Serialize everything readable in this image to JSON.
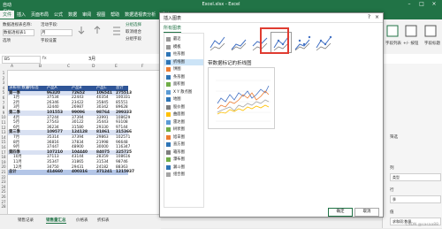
{
  "app": {
    "title": "Excel.xlsx - Excel",
    "icon_label": "自动保存"
  },
  "ribbon_tabs": [
    "文件",
    "插入",
    "页面布局",
    "公式",
    "数据",
    "审阅",
    "视图",
    "帮助",
    "数据透视表分析",
    "设计"
  ],
  "active_ribbon_tab": 0,
  "ribbon": {
    "pivot_name_label": "数据透视表名称:",
    "pivot_name_value": "数据透视表1",
    "active_field_label": "活动字段:",
    "active_field_value": "月",
    "options_label": "选项",
    "field_settings_label": "字段设置",
    "group_select_label": "分组选择",
    "ungroup_label": "取消组合",
    "group_field_label": "分组字段",
    "field_list_label": "字段列表",
    "buttons_label": "+/- 按钮",
    "field_headers_label": "字段标题"
  },
  "formula_bar": {
    "name_box": "B5",
    "fx": "fx",
    "value": "3月"
  },
  "columns": [
    "A",
    "B",
    "C",
    "D",
    "E",
    "F"
  ],
  "rows": [
    "1",
    "2",
    "3",
    "4",
    "5",
    "6",
    "7",
    "8",
    "9",
    "10",
    "11",
    "12",
    "13",
    "14",
    "15",
    "16",
    "17",
    "18",
    "19",
    "20",
    "21",
    "22",
    "23",
    "24",
    "25",
    "26",
    "27",
    "28"
  ],
  "pivot": {
    "header": [
      "求和项:数量",
      "列标签",
      "产品A",
      "产品B",
      "产品C",
      "总计"
    ],
    "rows": [
      {
        "type": "quarter",
        "label": "第一季",
        "v": [
          "96320",
          "72652",
          "106541",
          "275513"
        ]
      },
      {
        "type": "month",
        "label": "1月",
        "v": [
          "37534",
          "22443",
          "40354",
          "100331"
        ]
      },
      {
        "type": "month",
        "label": "2月",
        "v": [
          "26346",
          "23422",
          "35845",
          "85551"
        ]
      },
      {
        "type": "month",
        "label": "3月",
        "v": [
          "32440",
          "26987",
          "30342",
          "89628"
        ]
      },
      {
        "type": "quarter",
        "label": "第二季",
        "v": [
          "101553",
          "99096",
          "98764",
          "299333"
        ]
      },
      {
        "type": "month",
        "label": "4月",
        "v": [
          "37244",
          "37394",
          "33991",
          "108629"
        ]
      },
      {
        "type": "month",
        "label": "5月",
        "v": [
          "27543",
          "30122",
          "35443",
          "93108"
        ]
      },
      {
        "type": "month",
        "label": "6月",
        "v": [
          "36234",
          "31580",
          "29330",
          "97144"
        ]
      },
      {
        "type": "quarter",
        "label": "第三季",
        "v": [
          "109577",
          "124128",
          "81861",
          "315366"
        ]
      },
      {
        "type": "month",
        "label": "7月",
        "v": [
          "35314",
          "37394",
          "29863",
          "102571"
        ]
      },
      {
        "type": "month",
        "label": "8月",
        "v": [
          "36816",
          "37834",
          "21998",
          "96648"
        ]
      },
      {
        "type": "month",
        "label": "9月",
        "v": [
          "37447",
          "48900",
          "30000",
          "116347"
        ]
      },
      {
        "type": "quarter",
        "label": "第四季",
        "v": [
          "107210",
          "104440",
          "84075",
          "325725"
        ]
      },
      {
        "type": "month",
        "label": "10月",
        "v": [
          "37113",
          "43144",
          "28359",
          "108616"
        ]
      },
      {
        "type": "month",
        "label": "11月",
        "v": [
          "35347",
          "31865",
          "31534",
          "98746"
        ]
      },
      {
        "type": "month",
        "label": "12月",
        "v": [
          "34750",
          "29431",
          "24182",
          "88363"
        ]
      },
      {
        "type": "total",
        "label": "总计",
        "v": [
          "414660",
          "400316",
          "371241",
          "1215937"
        ]
      }
    ]
  },
  "sheet_tabs": [
    "销售记录",
    "销售量汇总",
    "价格表",
    "折扣表"
  ],
  "active_sheet_tab": 1,
  "dialog": {
    "title": "插入图表",
    "help": "?",
    "close": "×",
    "tab": "所有图表",
    "categories": [
      {
        "label": "最近",
        "icon": "recent-icon"
      },
      {
        "label": "模板",
        "icon": "template-icon"
      },
      {
        "label": "柱形图",
        "icon": "column-chart-icon"
      },
      {
        "label": "折线图",
        "icon": "line-chart-icon"
      },
      {
        "label": "饼图",
        "icon": "pie-chart-icon"
      },
      {
        "label": "条形图",
        "icon": "bar-chart-icon"
      },
      {
        "label": "面积图",
        "icon": "area-chart-icon"
      },
      {
        "label": "X Y 散点图",
        "icon": "scatter-chart-icon"
      },
      {
        "label": "地图",
        "icon": "map-chart-icon"
      },
      {
        "label": "股价图",
        "icon": "stock-chart-icon"
      },
      {
        "label": "曲面图",
        "icon": "surface-chart-icon"
      },
      {
        "label": "雷达图",
        "icon": "radar-chart-icon"
      },
      {
        "label": "树状图",
        "icon": "treemap-chart-icon"
      },
      {
        "label": "旭日图",
        "icon": "sunburst-chart-icon"
      },
      {
        "label": "直方图",
        "icon": "histogram-chart-icon"
      },
      {
        "label": "箱形图",
        "icon": "box-chart-icon"
      },
      {
        "label": "瀑布图",
        "icon": "waterfall-chart-icon"
      },
      {
        "label": "漏斗图",
        "icon": "funnel-chart-icon"
      },
      {
        "label": "组合图",
        "icon": "combo-chart-icon"
      }
    ],
    "active_category": 3,
    "subtypes": [
      "line-icon",
      "stacked-line-icon",
      "percent-line-icon",
      "line-markers-icon",
      "stacked-line-markers-icon",
      "3d-line-icon"
    ],
    "active_subtype": 3,
    "subtype_title": "带数据标记的折线图",
    "ok": "确定",
    "cancel": "取消"
  },
  "right_pane": {
    "filter_label": "筛选",
    "columns_label": "列",
    "columns_value": "类型",
    "rows_label": "行",
    "rows_value": "季",
    "values_label": "值",
    "values_value": "求和项:数量"
  },
  "watermark": "CSDN @sasaa88"
}
